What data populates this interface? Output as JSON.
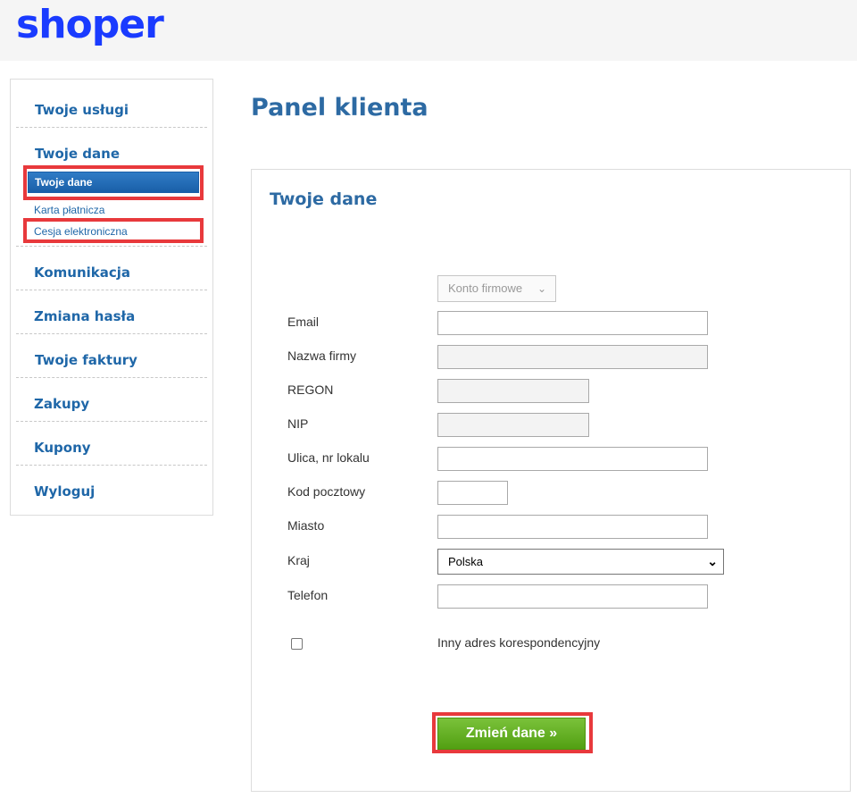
{
  "header": {
    "logo_text": "shoper"
  },
  "page": {
    "title": "Panel klienta"
  },
  "sidebar": {
    "items": [
      {
        "label": "Twoje usługi"
      },
      {
        "label": "Twoje dane"
      },
      {
        "label": "Komunikacja"
      },
      {
        "label": "Zmiana hasła"
      },
      {
        "label": "Twoje faktury"
      },
      {
        "label": "Zakupy"
      },
      {
        "label": "Kupony"
      },
      {
        "label": "Wyloguj"
      }
    ],
    "subitems": [
      {
        "label": "Twoje dane",
        "active": true
      },
      {
        "label": "Karta płatnicza"
      },
      {
        "label": "Cesja elektroniczna"
      }
    ]
  },
  "form": {
    "section_title": "Twoje dane",
    "account_type": {
      "selected": "Konto firmowe"
    },
    "fields": {
      "email": {
        "label": "Email",
        "value": ""
      },
      "company": {
        "label": "Nazwa firmy",
        "value": ""
      },
      "regon": {
        "label": "REGON",
        "value": ""
      },
      "nip": {
        "label": "NIP",
        "value": ""
      },
      "street": {
        "label": "Ulica, nr lokalu",
        "value": ""
      },
      "postal": {
        "label": "Kod pocztowy",
        "value": ""
      },
      "city": {
        "label": "Miasto",
        "value": ""
      },
      "country": {
        "label": "Kraj",
        "selected": "Polska"
      },
      "phone": {
        "label": "Telefon",
        "value": ""
      }
    },
    "other_address_label": "Inny adres korespondencyjny",
    "submit_label": "Zmień dane »"
  },
  "colors": {
    "brand": "#1a3bff",
    "accent": "#2d6aa3",
    "link": "#1f67a8",
    "submit": "#5fae1f",
    "highlight": "#e8393c"
  }
}
